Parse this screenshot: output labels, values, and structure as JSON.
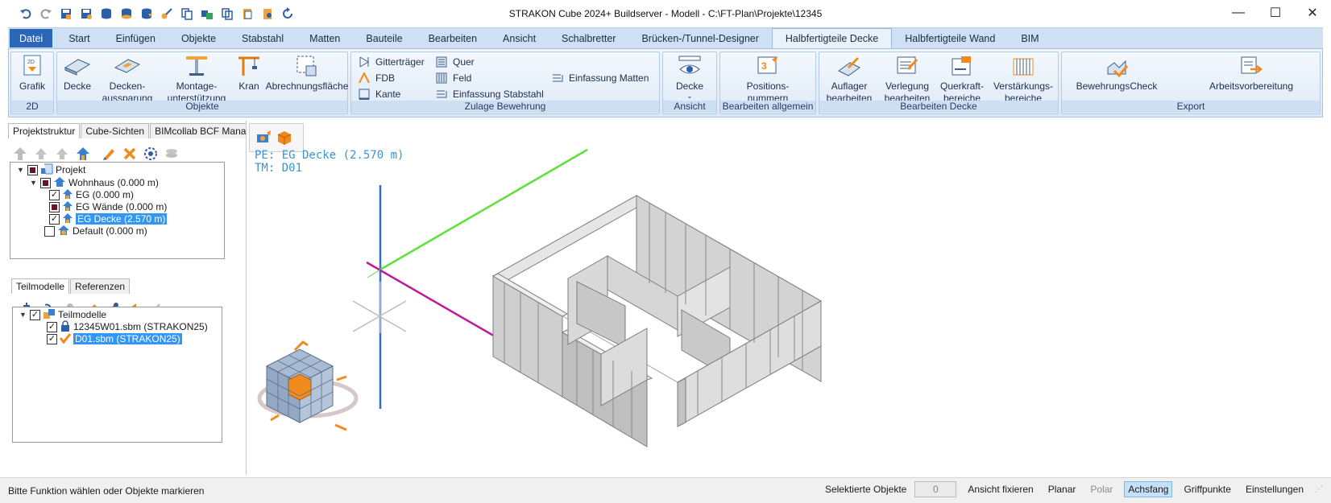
{
  "window": {
    "title": "STRAKON Cube 2024+ Buildserver - Modell - C:\\FT-Plan\\Projekte\\12345",
    "minimize_glyph": "—",
    "maximize_glyph": "☐",
    "close_glyph": "✕"
  },
  "tabs": [
    {
      "label": "Datei"
    },
    {
      "label": "Start"
    },
    {
      "label": "Einfügen"
    },
    {
      "label": "Objekte"
    },
    {
      "label": "Stabstahl"
    },
    {
      "label": "Matten"
    },
    {
      "label": "Bauteile"
    },
    {
      "label": "Bearbeiten"
    },
    {
      "label": "Ansicht"
    },
    {
      "label": "Schalbretter"
    },
    {
      "label": "Brücken-/Tunnel-Designer"
    },
    {
      "label": "Halbfertigteile Decke"
    },
    {
      "label": "Halbfertigteile Wand"
    },
    {
      "label": "BIM"
    }
  ],
  "ribbon": {
    "g2d": {
      "label": "2D",
      "grafik": "Grafik"
    },
    "objekte": {
      "label": "Objekte",
      "decke": "Decke",
      "aussparung1": "Decken-",
      "aussparung2": "aussparung",
      "montage1": "Montage-",
      "montage2": "unterstützung",
      "kran": "Kran",
      "abrechnung": "Abrechnungsfläche"
    },
    "zulage": {
      "label": "Zulage Bewehrung",
      "gitter": "Gitterträger",
      "fdb": "FDB",
      "kante": "Kante",
      "quer": "Quer",
      "feld": "Feld",
      "einf_stab": "Einfassung Stabstahl",
      "einf_matten": "Einfassung Matten"
    },
    "ansicht": {
      "label": "Ansicht",
      "decke": "Decke",
      "arrow": "⌄"
    },
    "bearb_allg": {
      "label": "Bearbeiten allgemein",
      "pos1": "Positions-",
      "pos2": "nummern"
    },
    "bearb_decke": {
      "label": "Bearbeiten Decke",
      "auflager1": "Auflager",
      "auflager2": "bearbeiten",
      "verlegung1": "Verlegung",
      "verlegung2": "bearbeiten",
      "querkraft1": "Querkraft-",
      "querkraft2": "bereiche",
      "verst1": "Verstärkungs-",
      "verst2": "bereiche"
    },
    "export": {
      "label": "Export",
      "check": "BewehrungsCheck",
      "arbeit": "Arbeitsvorbereitung"
    }
  },
  "projekt_panel": {
    "tabs": [
      "Projektstruktur",
      "Cube-Sichten",
      "BIMcollab BCF Manager"
    ],
    "tree": [
      {
        "label": "Projekt"
      },
      {
        "label": "Wohnhaus (0.000 m)"
      },
      {
        "label": "EG (0.000 m)"
      },
      {
        "label": "EG Wände (0.000 m)"
      },
      {
        "label": "EG Decke (2.570 m)"
      },
      {
        "label": "Default (0.000 m)"
      }
    ]
  },
  "teilmodelle_panel": {
    "tabs": [
      "Teilmodelle",
      "Referenzen"
    ],
    "tree": [
      {
        "label": "Teilmodelle"
      },
      {
        "label": "12345W01.sbm (STRAKON25)"
      },
      {
        "label": "D01.sbm (STRAKON25)"
      }
    ]
  },
  "viewport": {
    "pe_label": "PE: EG Decke (2.570 m)",
    "tm_label": "TM: D01"
  },
  "status": {
    "message": "Bitte Funktion wählen oder Objekte markieren",
    "selected_label": "Selektierte Objekte",
    "selected_count": "0",
    "ansicht_fixieren": "Ansicht fixieren",
    "planar": "Planar",
    "polar": "Polar",
    "achsfang": "Achsfang",
    "griffpunkte": "Griffpunkte",
    "einstellungen": "Einstellungen"
  },
  "colors": {
    "accent": "#2b66b8",
    "selection": "#3396f3",
    "axis_x": "#c0189a",
    "axis_y": "#5fe03a",
    "axis_z": "#2f6fd0",
    "cube": "#f28a1e"
  }
}
